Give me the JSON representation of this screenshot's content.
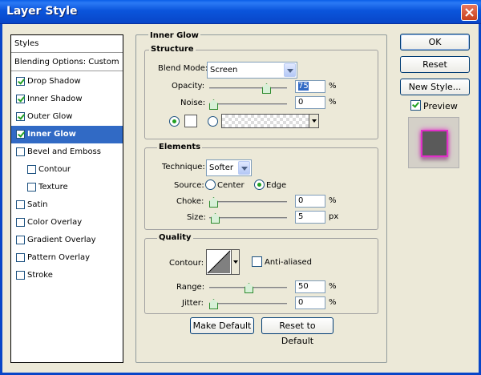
{
  "window": {
    "title": "Layer Style"
  },
  "styles_panel": {
    "header": "Styles",
    "blending": "Blending Options: Custom",
    "items": [
      {
        "label": "Drop Shadow",
        "checked": true,
        "indent": false
      },
      {
        "label": "Inner Shadow",
        "checked": true,
        "indent": false
      },
      {
        "label": "Outer Glow",
        "checked": true,
        "indent": false
      },
      {
        "label": "Inner Glow",
        "checked": true,
        "indent": false,
        "selected": true
      },
      {
        "label": "Bevel and Emboss",
        "checked": false,
        "indent": false
      },
      {
        "label": "Contour",
        "checked": false,
        "indent": true
      },
      {
        "label": "Texture",
        "checked": false,
        "indent": true
      },
      {
        "label": "Satin",
        "checked": false,
        "indent": false
      },
      {
        "label": "Color Overlay",
        "checked": false,
        "indent": false
      },
      {
        "label": "Gradient Overlay",
        "checked": false,
        "indent": false
      },
      {
        "label": "Pattern Overlay",
        "checked": false,
        "indent": false
      },
      {
        "label": "Stroke",
        "checked": false,
        "indent": false
      }
    ]
  },
  "inner_glow": {
    "title": "Inner Glow",
    "structure": {
      "title": "Structure",
      "blend_mode_label": "Blend Mode:",
      "blend_mode_value": "Screen",
      "opacity_label": "Opacity:",
      "opacity_value": "75",
      "opacity_unit": "%",
      "opacity_fraction": 0.75,
      "noise_label": "Noise:",
      "noise_value": "0",
      "noise_unit": "%",
      "noise_fraction": 0
    },
    "elements": {
      "title": "Elements",
      "technique_label": "Technique:",
      "technique_value": "Softer",
      "source_label": "Source:",
      "source_center": "Center",
      "source_edge": "Edge",
      "choke_label": "Choke:",
      "choke_value": "0",
      "choke_unit": "%",
      "size_label": "Size:",
      "size_value": "5",
      "size_unit": "px"
    },
    "quality": {
      "title": "Quality",
      "contour_label": "Contour:",
      "anti_aliased_label": "Anti-aliased",
      "range_label": "Range:",
      "range_value": "50",
      "range_unit": "%",
      "range_fraction": 0.5,
      "jitter_label": "Jitter:",
      "jitter_value": "0",
      "jitter_unit": "%"
    },
    "make_default": "Make Default",
    "reset_to_default": "Reset to Default"
  },
  "buttons": {
    "ok": "OK",
    "reset": "Reset",
    "new_style": "New Style...",
    "preview": "Preview"
  },
  "colors": {
    "glow_swatch": "#ffffff",
    "preview_glow": "#e030c8"
  }
}
